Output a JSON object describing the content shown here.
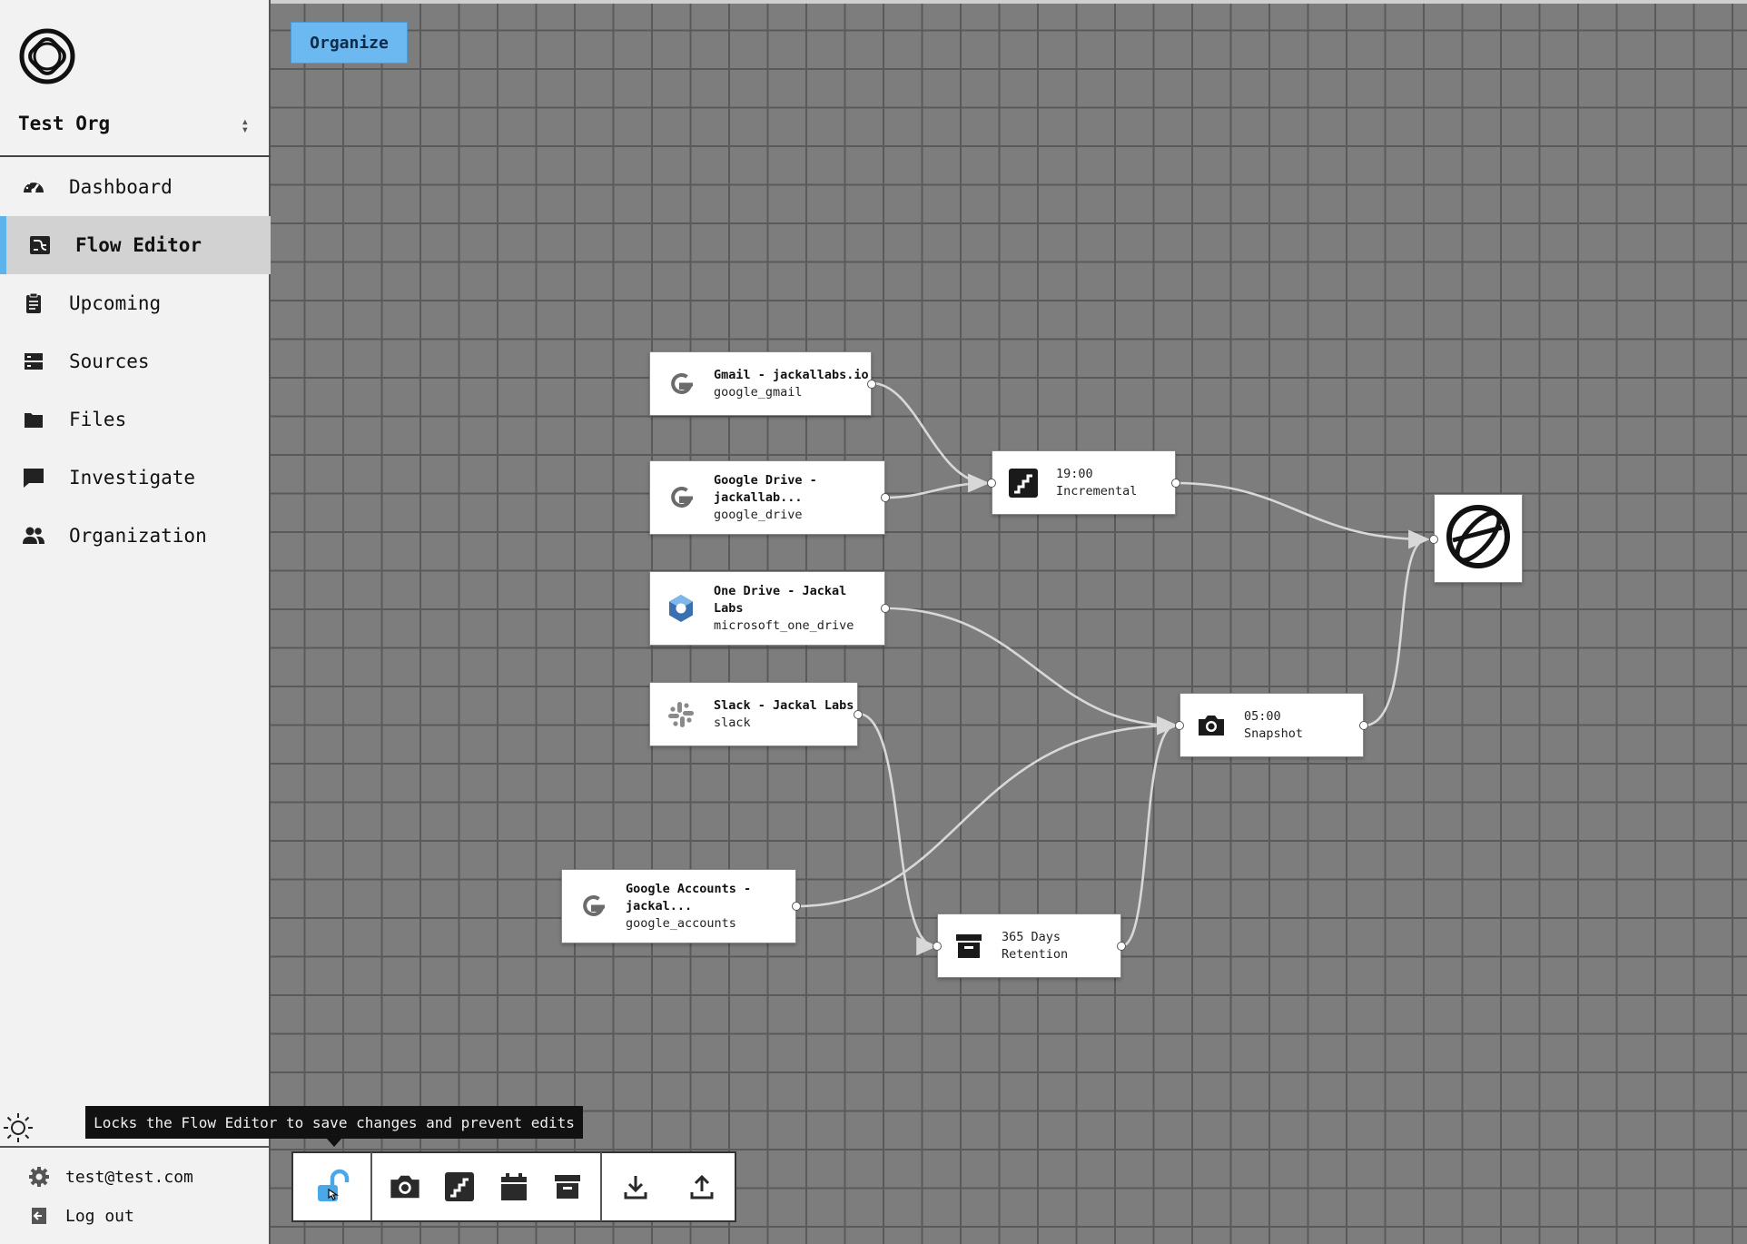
{
  "sidebar": {
    "org_name": "Test Org",
    "nav": [
      {
        "label": "Dashboard",
        "icon": "dashboard-gauge-icon"
      },
      {
        "label": "Flow Editor",
        "icon": "flow-editor-icon",
        "active": true
      },
      {
        "label": "Upcoming",
        "icon": "clipboard-icon"
      },
      {
        "label": "Sources",
        "icon": "server-icon"
      },
      {
        "label": "Files",
        "icon": "folder-icon"
      },
      {
        "label": "Investigate",
        "icon": "chat-bubble-icon"
      },
      {
        "label": "Organization",
        "icon": "people-icon"
      }
    ],
    "account_email": "test@test.com",
    "logout_label": "Log out"
  },
  "canvas": {
    "organize_label": "Organize",
    "nodes": {
      "gmail": {
        "title": "Gmail - jackallabs.io",
        "subtitle": "google_gmail",
        "icon": "google-icon"
      },
      "gdrive": {
        "title_line1": "Google Drive -",
        "title_line2": "jackallab...",
        "subtitle": "google_drive",
        "icon": "google-icon"
      },
      "onedrive": {
        "title_line1": "One Drive - Jackal",
        "title_line2": "Labs",
        "subtitle": "microsoft_one_drive",
        "icon": "microsoft-onedrive-icon"
      },
      "slack": {
        "title": "Slack - Jackal Labs",
        "subtitle": "slack",
        "icon": "slack-icon"
      },
      "gaccounts": {
        "title_line1": "Google Accounts -",
        "title_line2": "jackal...",
        "subtitle": "google_accounts",
        "icon": "google-icon"
      },
      "incremental": {
        "time": "19:00",
        "label": "Incremental",
        "icon": "stairs-icon"
      },
      "snapshot": {
        "time": "05:00",
        "label": "Snapshot",
        "icon": "camera-icon"
      },
      "retention": {
        "time": "365 Days",
        "label": "Retention",
        "icon": "archive-box-icon"
      },
      "destination": {
        "icon": "globe-icon"
      }
    }
  },
  "tooltip": "Locks the Flow Editor to save changes and prevent edits",
  "toolbar": {
    "buttons": [
      "unlock-icon",
      "camera-icon",
      "stairs-icon",
      "calendar-icon",
      "archive-box-icon",
      "download-icon",
      "upload-icon"
    ]
  },
  "colors": {
    "accent": "#6cb8f0",
    "canvas_bg": "#7d7d7d",
    "grid_line": "#5a5a5a",
    "sidebar_bg": "#f2f2f2",
    "active_nav_bg": "#d2d2d2",
    "edge": "#d8d8d8"
  }
}
